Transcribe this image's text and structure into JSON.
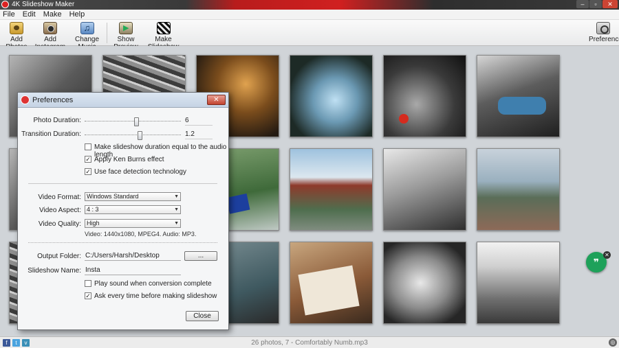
{
  "window": {
    "title": "4K Slideshow Maker",
    "controls": [
      "–",
      "▫",
      "✕"
    ]
  },
  "menu": {
    "items": [
      "File",
      "Edit",
      "Make",
      "Help"
    ]
  },
  "toolbar": {
    "add_photos": "Add Photos",
    "add_instagram": "Add Instagram",
    "change_music": "Change Music",
    "show_preview": "Show Preview",
    "make_slideshow": "Make Slideshow",
    "preferences": "Preferences"
  },
  "gallery": {
    "thumbnails": [
      "photo-1",
      "photo-2",
      "photo-3",
      "photo-4",
      "photo-5",
      "photo-6",
      "photo-7",
      "photo-8",
      "photo-9",
      "photo-10",
      "photo-11",
      "photo-12",
      "photo-13",
      "photo-14"
    ]
  },
  "badge": {
    "icon": "chat-icon",
    "glyph": "❞",
    "close": "✕"
  },
  "status": {
    "text": "26 photos, 7 - Comfortably Numb.mp3",
    "social": [
      "f",
      "t",
      "v"
    ]
  },
  "preferences": {
    "title": "Preferences",
    "photo_duration": {
      "label": "Photo Duration:",
      "value": "6",
      "fraction": 0.54
    },
    "transition_duration": {
      "label": "Transition Duration:",
      "value": "1.2",
      "fraction": 0.58
    },
    "checkboxes": [
      {
        "label": "Make slideshow duration equal to the audio length",
        "checked": false
      },
      {
        "label": "Apply Ken Burns effect",
        "checked": true
      },
      {
        "label": "Use face detection technology",
        "checked": true
      }
    ],
    "video_format": {
      "label": "Video Format:",
      "value": "Windows Standard"
    },
    "video_aspect": {
      "label": "Video Aspect:",
      "value": "4 : 3"
    },
    "video_quality": {
      "label": "Video Quality:",
      "value": "High"
    },
    "video_info": "Video: 1440x1080, MPEG4. Audio: MP3.",
    "output_folder": {
      "label": "Output Folder:",
      "value": "C:/Users/Harsh/Desktop",
      "browse": "..."
    },
    "slideshow_name": {
      "label": "Slideshow Name:",
      "value": "Insta"
    },
    "checkboxes2": [
      {
        "label": "Play sound when conversion complete",
        "checked": false
      },
      {
        "label": "Ask every time before making slideshow",
        "checked": true
      }
    ],
    "close_button": "Close"
  }
}
